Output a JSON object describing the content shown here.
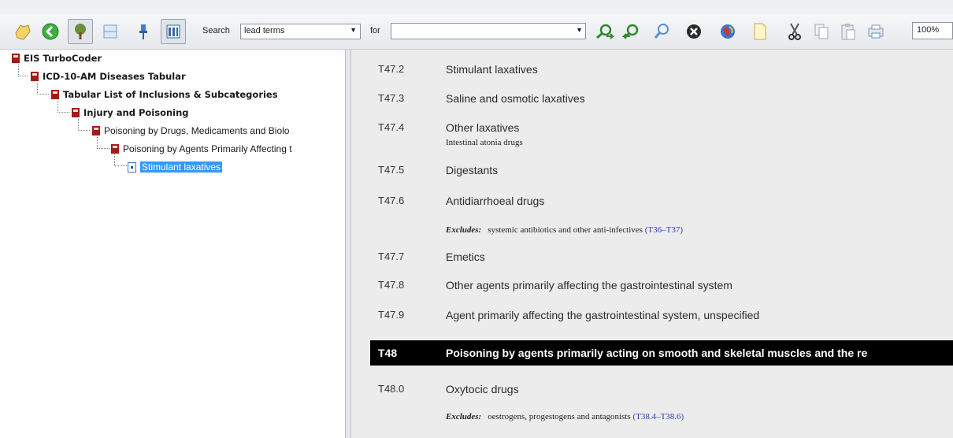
{
  "toolbar": {
    "search_label": "Search",
    "search_value": "lead terms",
    "for_label": "for",
    "for_value": "",
    "zoom": "100%",
    "icons": [
      "hand-pointer-icon",
      "back-green-icon",
      "tree-view-icon",
      "list-view-icon",
      "pin-icon",
      "columns-icon",
      "search-forward-icon",
      "search-backward-icon",
      "magnifier-icon",
      "stop-icon",
      "globe-icon",
      "new-page-icon",
      "cut-icon",
      "copy-icon",
      "paste-icon",
      "print-icon"
    ]
  },
  "tree": {
    "nodes": [
      {
        "label": "EIS TurboCoder",
        "bold": true
      },
      {
        "label": "ICD-10-AM Diseases Tabular",
        "bold": true
      },
      {
        "label": "Tabular List of Inclusions & Subcategories",
        "bold": true
      },
      {
        "label": "Injury and Poisoning",
        "bold": true
      },
      {
        "label": "Poisoning by Drugs, Medicaments and Biolo",
        "bold": false
      },
      {
        "label": "Poisoning by Agents Primarily Affecting t",
        "bold": false
      },
      {
        "label": "Stimulant laxatives",
        "bold": false,
        "selected": true
      }
    ]
  },
  "content": {
    "entries": [
      {
        "code": "T47.2",
        "title": "Stimulant laxatives"
      },
      {
        "code": "T47.3",
        "title": "Saline and osmotic laxatives"
      },
      {
        "code": "T47.4",
        "title": "Other laxatives",
        "sub": "Intestinal atonia drugs"
      },
      {
        "code": "T47.5",
        "title": "Digestants"
      },
      {
        "code": "T47.6",
        "title": "Antidiarrhoeal drugs",
        "excludes_label": "Excludes:",
        "excludes_text": "systemic antibiotics and other anti-infectives",
        "excludes_ref": "(T36–T37)"
      },
      {
        "code": "T47.7",
        "title": "Emetics"
      },
      {
        "code": "T47.8",
        "title": "Other agents primarily affecting the gastrointestinal system"
      },
      {
        "code": "T47.9",
        "title": "Agent primarily affecting the gastrointestinal system, unspecified"
      }
    ],
    "header": {
      "code": "T48",
      "title": "Poisoning by agents primarily acting on smooth and skeletal muscles and the re"
    },
    "after": [
      {
        "code": "T48.0",
        "title": "Oxytocic drugs",
        "excludes_label": "Excludes:",
        "excludes_text": "oestrogens, progestogens and antagonists",
        "excludes_ref": "(T38.4–T38.6)"
      }
    ]
  },
  "colors": {
    "selection": "#3399ff",
    "header_band": "#000000",
    "reference_link": "#2a3fb5",
    "book_icon": "#a31a1a"
  }
}
